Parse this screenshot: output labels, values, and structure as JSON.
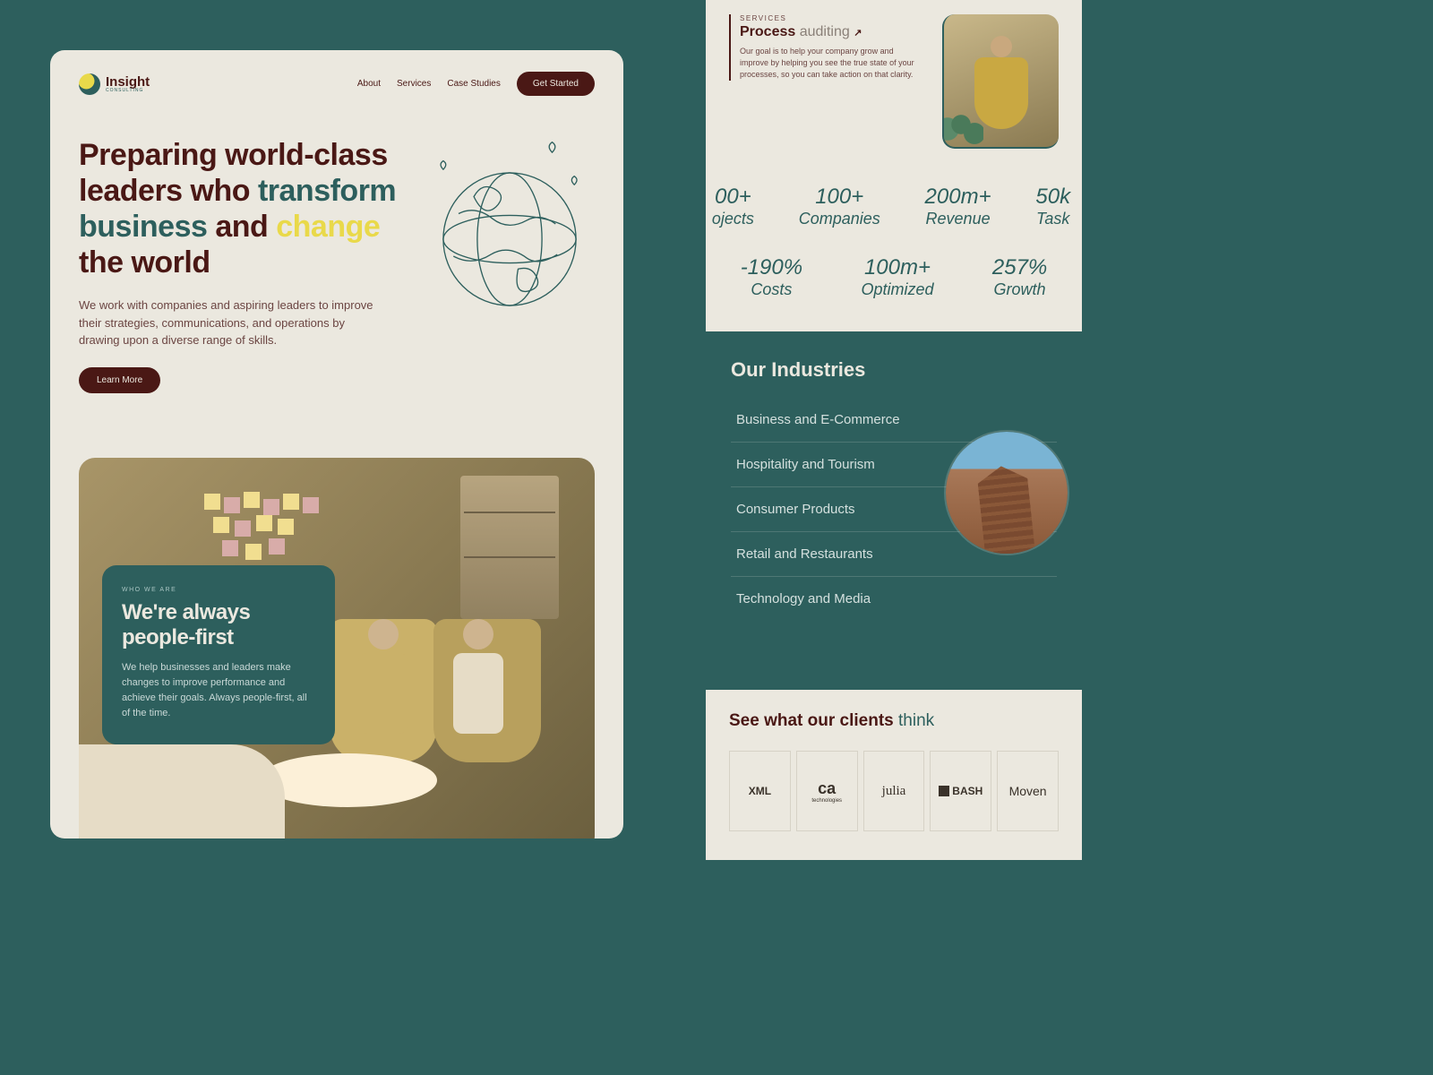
{
  "nav": {
    "brand": "Insight",
    "brand_sub": "CONSULTING",
    "links": [
      "About",
      "Services",
      "Case Studies"
    ],
    "cta": "Get Started"
  },
  "hero": {
    "h1_part1": "Preparing world-class leaders who ",
    "h1_teal": "transform business",
    "h1_part2": " and ",
    "h1_yellow": "change",
    "h1_part3": " the world",
    "sub": "We work with companies and aspiring leaders to improve their strategies, communications, and operations by drawing upon a diverse range of skills.",
    "learn": "Learn More"
  },
  "who": {
    "eyebrow": "WHO WE ARE",
    "title": "We're always people-first",
    "body": "We help businesses and leaders make changes to improve performance and achieve their goals. Always people-first, all of the time."
  },
  "services": {
    "label": "SERVICES",
    "title_bold": "Process",
    "title_light": "auditing",
    "arrow": "↗",
    "desc": "Our goal is to help your company grow and improve by helping you see the true state of your processes, so you can take action on that clarity."
  },
  "stats": {
    "row1": [
      {
        "num": "00+",
        "lbl": "ojects"
      },
      {
        "num": "100+",
        "lbl": "Companies"
      },
      {
        "num": "200m+",
        "lbl": "Revenue"
      },
      {
        "num": "50k",
        "lbl": "Task"
      }
    ],
    "row2": [
      {
        "num": "-190%",
        "lbl": "Costs"
      },
      {
        "num": "100m+",
        "lbl": "Optimized"
      },
      {
        "num": "257%",
        "lbl": "Growth"
      }
    ]
  },
  "industries": {
    "heading": "Our Industries",
    "items": [
      "Business and E-Commerce",
      "Hospitality and Tourism",
      "Consumer Products",
      "Retail and Restaurants",
      "Technology and Media"
    ]
  },
  "clients": {
    "heading_dark": "See what our clients ",
    "heading_teal": "think",
    "logos": {
      "xml": "XML",
      "ca_big": "ca",
      "ca_small": "technologies",
      "julia": "julia",
      "bash": "BASH",
      "moven": "Moven"
    }
  }
}
